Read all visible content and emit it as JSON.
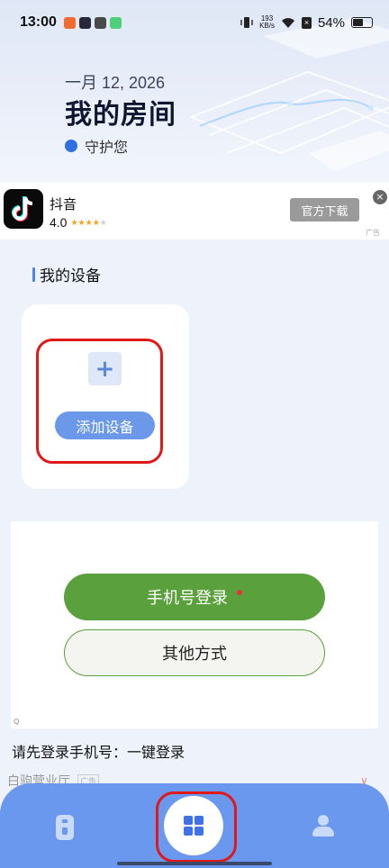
{
  "status_bar": {
    "time": "13:00",
    "net_speed_value": "193",
    "net_speed_unit": "KB/s",
    "battery": "54%",
    "battery_level": 0.54
  },
  "header": {
    "date": "一月 12, 2026",
    "title": "我的房间",
    "guard_text": "守护您"
  },
  "ad": {
    "app_name": "抖音",
    "rating": "4.0",
    "stars_filled": 4,
    "stars_total": 5,
    "download_label": "官方下载",
    "close_label": "×",
    "tag": "广告"
  },
  "devices": {
    "section_title": "我的设备",
    "plus_label": "+",
    "add_device_label": "添加设备"
  },
  "login": {
    "phone_login_label": "手机号登录",
    "other_label": "其他方式",
    "prompt": "请先登录手机号：一键登录"
  },
  "peek": {
    "text": "白驹营业厅",
    "tag": "广告"
  },
  "colors": {
    "accent": "#6b98ef",
    "login_green": "#5aa03c",
    "highlight_red": "#e01818"
  }
}
